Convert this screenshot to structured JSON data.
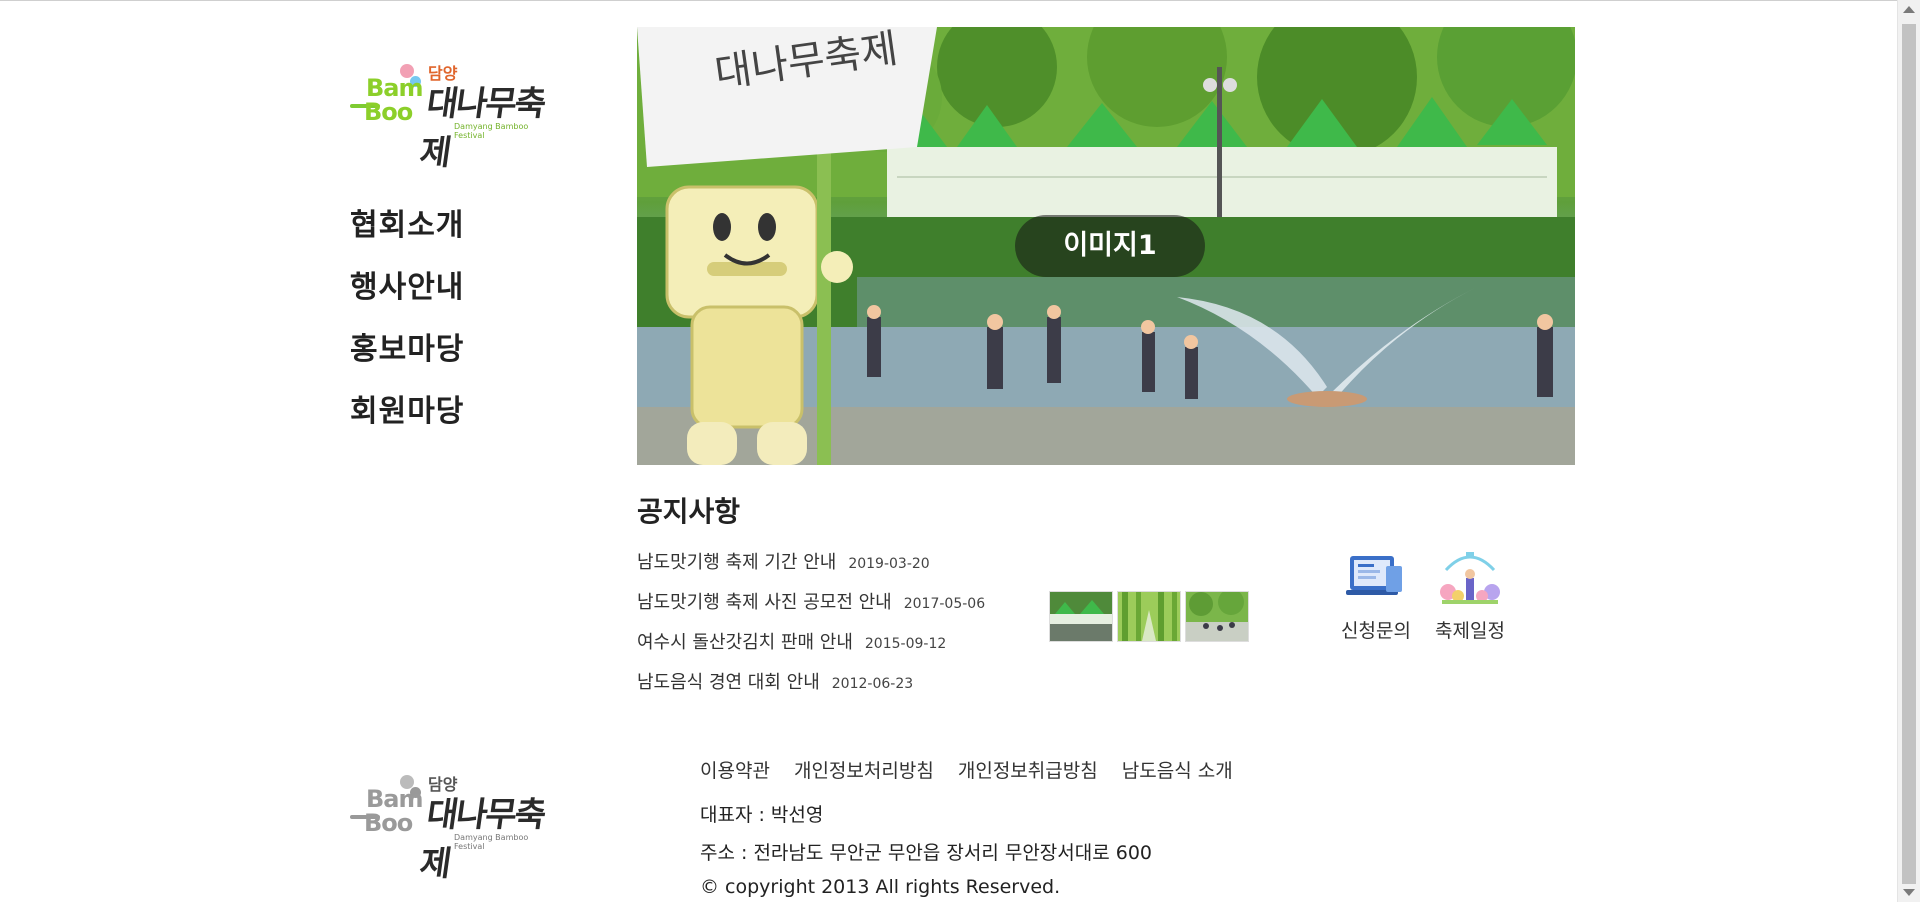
{
  "logo": {
    "brand_en_1": "Bam",
    "brand_en_2": "Boo",
    "brand_kr_small": "담양",
    "brand_kr_big": "대나무축제",
    "tagline": "Damyang Bamboo Festival"
  },
  "nav": {
    "items": [
      {
        "label": "협회소개"
      },
      {
        "label": "행사안내"
      },
      {
        "label": "홍보마당"
      },
      {
        "label": "회원마당"
      }
    ]
  },
  "hero": {
    "caption": "이미지1",
    "flag_text": "대나무축제"
  },
  "notices": {
    "title": "공지사항",
    "items": [
      {
        "title": "남도맛기행 축제 기간 안내",
        "date": "2019-03-20"
      },
      {
        "title": "남도맛기행 축제 사진 공모전 안내",
        "date": "2017-05-06"
      },
      {
        "title": "여수시 돌산갓김치 판매 안내",
        "date": "2015-09-12"
      },
      {
        "title": "남도음식 경연 대회 안내",
        "date": "2012-06-23"
      }
    ]
  },
  "quick_links": [
    {
      "label": "신청문의",
      "icon": "application-inquiry-icon"
    },
    {
      "label": "축제일정",
      "icon": "festival-schedule-icon"
    }
  ],
  "footer": {
    "links": [
      {
        "label": "이용약관"
      },
      {
        "label": "개인정보처리방침"
      },
      {
        "label": "개인정보취급방침"
      },
      {
        "label": "남도음식 소개"
      }
    ],
    "representative": "대표자 : 박선영",
    "address": "주소 : 전라남도 무안군 무안읍 장서리 무안장서대로 600",
    "copyright": "© copyright 2013 All rights Reserved."
  },
  "colors": {
    "brand_green": "#8ccf2a",
    "brand_orange": "#e0652c",
    "text_dark": "#222222"
  }
}
